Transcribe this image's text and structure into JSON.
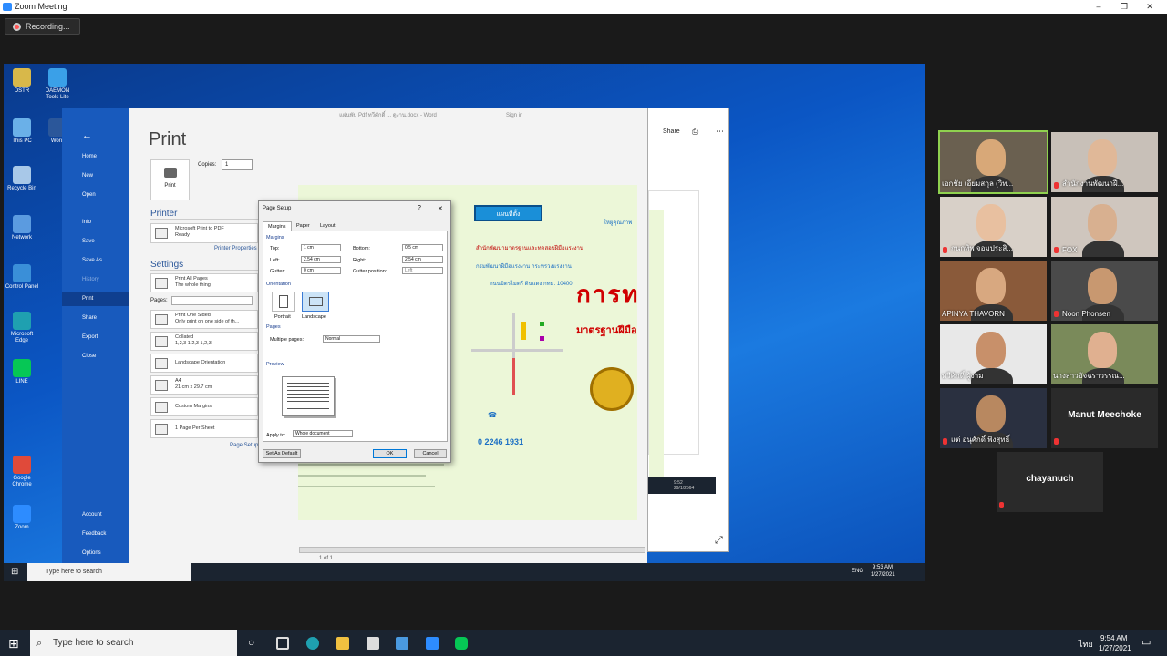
{
  "zoom": {
    "window_title": "Zoom Meeting",
    "recording_label": "Recording...",
    "window_buttons": [
      "–",
      "❐",
      "✕"
    ]
  },
  "shared_screen": {
    "desktop_icons": [
      {
        "label": "DSTR",
        "color": "#d8b84a"
      },
      {
        "label": "DAEMON Tools Lite",
        "color": "#3aa0e8"
      },
      {
        "label": "This PC",
        "color": "#6ab0e8"
      },
      {
        "label": "Word",
        "color": "#2b579a"
      },
      {
        "label": "Recycle Bin",
        "color": "#a8c8e8"
      },
      {
        "label": "Network",
        "color": "#5b9be0"
      },
      {
        "label": "Control Panel",
        "color": "#3a8fd8"
      },
      {
        "label": "Microsoft Edge",
        "color": "#1fa0b0"
      },
      {
        "label": "LINE",
        "color": "#06c755"
      },
      {
        "label": "Google Chrome",
        "color": "#e04a3a"
      },
      {
        "label": "Zoom",
        "color": "#2d8cff"
      }
    ],
    "word": {
      "window_title": "แผ่นพับ Pdf ทวีศักดิ์ ... ดูงาน.docx - Word",
      "sign_in": "Sign in",
      "nav": {
        "back": "←",
        "items": [
          "Home",
          "New",
          "Open",
          "Info",
          "Save",
          "Save As",
          "History",
          "Print",
          "Share",
          "Export",
          "Close"
        ],
        "selected": "Print",
        "bottom": [
          "Account",
          "Feedback",
          "Options"
        ]
      },
      "print": {
        "heading": "Print",
        "print_button": "Print",
        "copies_label": "Copies:",
        "copies_value": "1",
        "printer_section": "Printer",
        "printer_name": "Microsoft Print to PDF",
        "printer_status": "Ready",
        "printer_properties": "Printer Properties",
        "settings_section": "Settings",
        "pages_label": "Pages:",
        "settings": [
          {
            "line1": "Print All Pages",
            "line2": "The whole thing"
          },
          {
            "line1": "Print One Sided",
            "line2": "Only print on one side of th..."
          },
          {
            "line1": "Collated",
            "line2": "1,2,3    1,2,3    1,2,3"
          },
          {
            "line1": "Landscape Orientation",
            "line2": ""
          },
          {
            "line1": "A4",
            "line2": "21 cm x 29.7 cm"
          },
          {
            "line1": "Custom Margins",
            "line2": ""
          },
          {
            "line1": "1 Page Per Sheet",
            "line2": ""
          }
        ],
        "page_setup_link": "Page Setup"
      },
      "doc_preview": {
        "banner": "แผนที่ตั้ง",
        "big_title": "การท",
        "subtitle": "มาตรฐานฝีมือ",
        "phone": "0 2246 1931",
        "line_a": "สำนักพัฒนามาตรฐานและทดสอบฝีมือแรงงาน",
        "line_b": "กรมพัฒนาฝีมือแรงงาน กระทรวงแรงงาน",
        "line_c": "ถนนมิตรไมตรี ดินแดง กทม. 10400",
        "right_top": "ให้ผู้คุณภาพ",
        "page_label": "1 of 1"
      },
      "share_label": "Share",
      "pane_time": "9:52",
      "pane_date": "29/1/2564"
    },
    "page_setup": {
      "title": "Page Setup",
      "help": "?",
      "close": "✕",
      "tabs": [
        "Margins",
        "Paper",
        "Layout"
      ],
      "margins_group": "Margins",
      "top_label": "Top:",
      "top_value": "1 cm",
      "bottom_label": "Bottom:",
      "bottom_value": "0.5 cm",
      "left_label": "Left:",
      "left_value": "2.54 cm",
      "right_label": "Right:",
      "right_value": "2.54 cm",
      "gutter_label": "Gutter:",
      "gutter_value": "0 cm",
      "gutter_pos_label": "Gutter position:",
      "gutter_pos_value": "Left",
      "orientation_group": "Orientation",
      "portrait": "Portrait",
      "landscape": "Landscape",
      "pages_group": "Pages",
      "multiple_pages_label": "Multiple pages:",
      "multiple_pages_value": "Normal",
      "preview_group": "Preview",
      "apply_to_label": "Apply to:",
      "apply_to_value": "Whole document",
      "set_default": "Set As Default",
      "ok": "OK",
      "cancel": "Cancel"
    },
    "taskbar": {
      "search_placeholder": "Type here to search",
      "language": "ENG",
      "time": "9:53 AM",
      "date": "1/27/2021"
    }
  },
  "participants": [
    {
      "name": "เอกชัย เอี่ยมสกุล (วิท...",
      "muted": false,
      "active": true,
      "bg": "#6a6050",
      "skin": "#d8a878"
    },
    {
      "name": "สำนักงานพัฒนาฝี...",
      "muted": true,
      "active": false,
      "bg": "#c8c0b8",
      "skin": "#e0b898"
    },
    {
      "name": "กนกทิพ จอมประสิ...",
      "muted": true,
      "active": false,
      "bg": "#d8d0c8",
      "skin": "#e8c0a0"
    },
    {
      "name": "FOX",
      "muted": true,
      "active": false,
      "bg": "#cfc6be",
      "skin": "#d8b090"
    },
    {
      "name": "APINYA THAVORN",
      "muted": false,
      "active": false,
      "bg": "#8a5a3a",
      "skin": "#d8a880"
    },
    {
      "name": "Noon Phonsen",
      "muted": true,
      "active": false,
      "bg": "#4a4a4a",
      "skin": "#c89870"
    },
    {
      "name": "ทวีศักดิ์ ผู้งาม",
      "muted": false,
      "active": false,
      "bg": "#e8e8e8",
      "skin": "#c8906a"
    },
    {
      "name": "นางสาวอัจฉราวรรณ...",
      "muted": false,
      "active": false,
      "bg": "#7a8a5a",
      "skin": "#e0b090"
    },
    {
      "name": "แต่ อนุศักดิ์ พิงสุทธิ์",
      "muted": true,
      "active": false,
      "bg": "#2a3040",
      "skin": "#b88860"
    },
    {
      "name": "Manut Meechoke",
      "muted": true,
      "active": false,
      "bg": "#2a2a2a",
      "skin": ""
    },
    {
      "name": "chayanuch",
      "muted": true,
      "active": false,
      "bg": "#2a2a2a",
      "skin": ""
    }
  ],
  "host_taskbar": {
    "search_placeholder": "Type here to search",
    "language": "ไทย",
    "time": "9:54 AM",
    "date": "1/27/2021"
  }
}
